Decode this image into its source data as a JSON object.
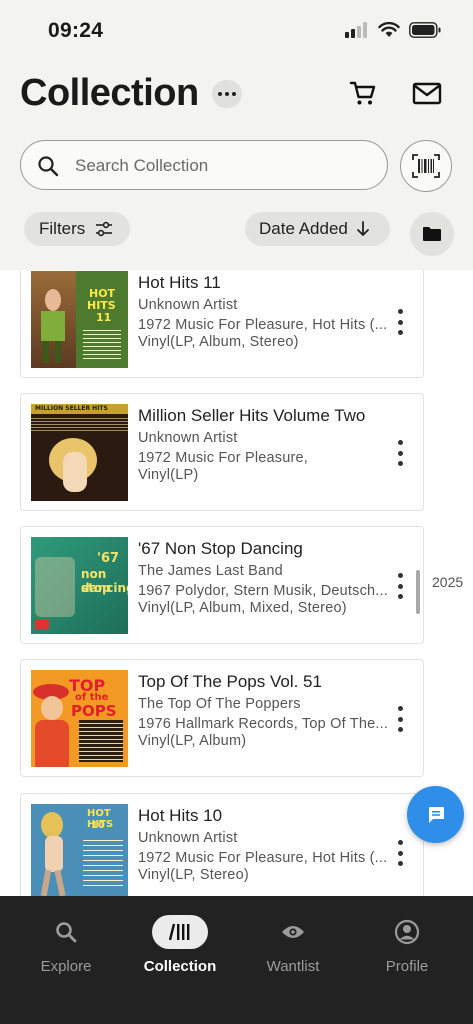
{
  "status_bar": {
    "time": "09:24"
  },
  "header": {
    "title": "Collection"
  },
  "search": {
    "placeholder": "Search Collection"
  },
  "toolbar": {
    "filters_label": "Filters",
    "sort_label": "Date Added"
  },
  "records": [
    {
      "title": "Hot Hits 11",
      "artist": "Unknown Artist",
      "label_line": "1972 Music For Pleasure, Hot Hits (...",
      "format": "Vinyl(LP, Album, Stereo)"
    },
    {
      "title": "Million Seller Hits Volume Two",
      "artist": "Unknown Artist",
      "label_line": "1972 Music For Pleasure,",
      "format": "Vinyl(LP)"
    },
    {
      "title": "'67 Non Stop Dancing",
      "artist": "The James Last Band",
      "label_line": "1967 Polydor, Stern Musik, Deutsch...",
      "format": "Vinyl(LP, Album, Mixed, Stereo)"
    },
    {
      "title": "Top Of The Pops Vol. 51",
      "artist": "The Top Of The Poppers",
      "label_line": "1976 Hallmark Records, Top Of The...",
      "format": "Vinyl(LP, Album)"
    },
    {
      "title": "Hot Hits 10",
      "artist": "Unknown Artist",
      "label_line": "1972 Music For Pleasure, Hot Hits (...",
      "format": "Vinyl(LP, Stereo)"
    }
  ],
  "scroll_indicator": {
    "year": "2025"
  },
  "bottom_nav": [
    {
      "label": "Explore"
    },
    {
      "label": "Collection"
    },
    {
      "label": "Wantlist"
    },
    {
      "label": "Profile"
    }
  ],
  "colors": {
    "accent": "#2f8ee8",
    "nav_bg": "#222222",
    "header_bg": "#f3f3f1"
  },
  "icons": [
    "search-icon",
    "cart-icon",
    "mail-icon",
    "barcode-icon",
    "sliders-icon",
    "arrow-down-icon",
    "folder-icon",
    "chat-icon",
    "collection-icon",
    "eye-icon",
    "profile-icon"
  ]
}
